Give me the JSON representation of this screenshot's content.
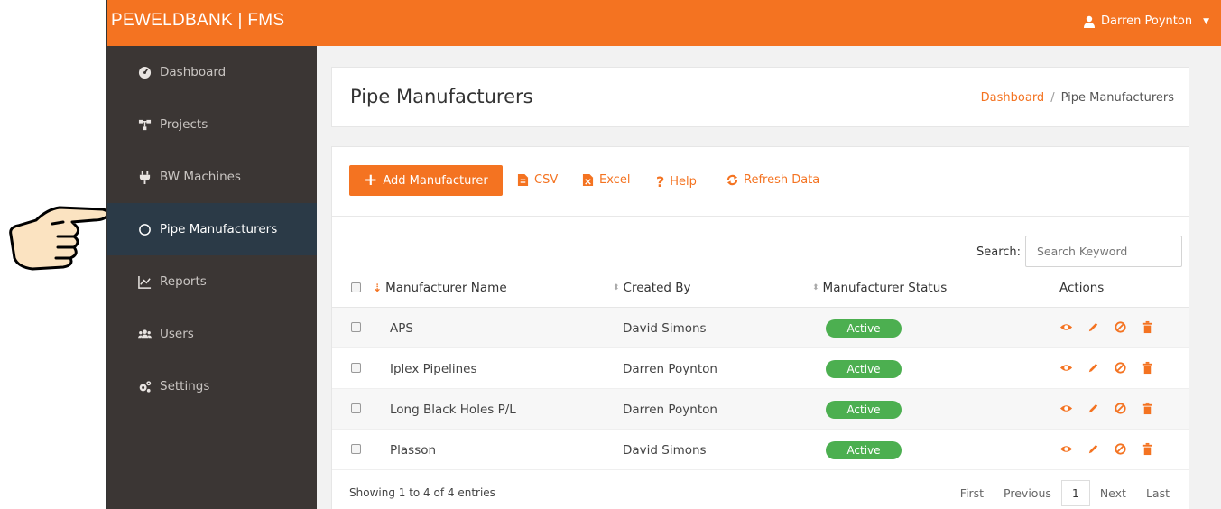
{
  "app": {
    "brand": "PEWELDBANK | FMS",
    "user_name": "Darren Poynton",
    "accent": "#f47321"
  },
  "sidebar": {
    "items": [
      {
        "label": "Dashboard",
        "icon": "dashboard-gauge-icon"
      },
      {
        "label": "Projects",
        "icon": "sitemap-icon"
      },
      {
        "label": "BW Machines",
        "icon": "plug-icon"
      },
      {
        "label": "Pipe Manufacturers",
        "icon": "circle-icon",
        "active": true
      },
      {
        "label": "Reports",
        "icon": "line-chart-icon"
      },
      {
        "label": "Users",
        "icon": "users-icon"
      },
      {
        "label": "Settings",
        "icon": "cogs-icon"
      }
    ]
  },
  "page": {
    "title": "Pipe Manufacturers",
    "breadcrumb": {
      "home": "Dashboard",
      "separator": "/",
      "current": "Pipe Manufacturers"
    }
  },
  "toolbar": {
    "add_label": "Add Manufacturer",
    "csv_label": "CSV",
    "excel_label": "Excel",
    "help_label": "Help",
    "refresh_label": "Refresh Data"
  },
  "search": {
    "label": "Search:",
    "placeholder": "Search Keyword",
    "value": ""
  },
  "table": {
    "columns": [
      "Manufacturer Name",
      "Created By",
      "Manufacturer Status",
      "Actions"
    ],
    "rows": [
      {
        "name": "APS",
        "created_by": "David Simons",
        "status": "Active"
      },
      {
        "name": "Iplex Pipelines",
        "created_by": "Darren Poynton",
        "status": "Active"
      },
      {
        "name": "Long Black Holes P/L",
        "created_by": "Darren Poynton",
        "status": "Active"
      },
      {
        "name": "Plasson",
        "created_by": "David Simons",
        "status": "Active"
      }
    ],
    "status_color": "#4caf50"
  },
  "footer": {
    "info": "Showing 1 to 4 of 4 entries",
    "pager": {
      "first": "First",
      "previous": "Previous",
      "current": "1",
      "next": "Next",
      "last": "Last"
    }
  }
}
